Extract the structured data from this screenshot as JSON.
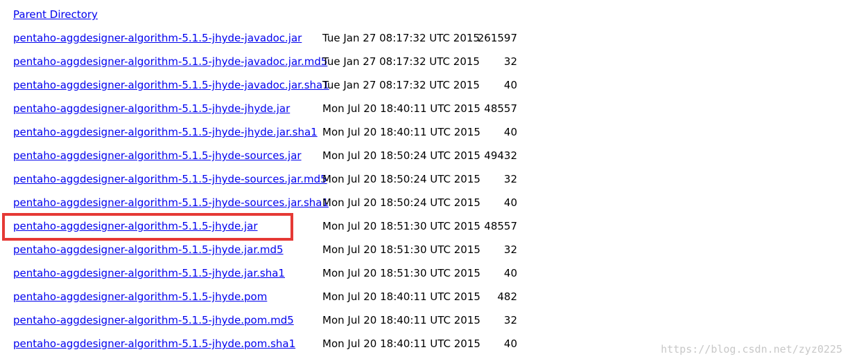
{
  "parent": {
    "label": "Parent Directory"
  },
  "files": [
    {
      "name": "pentaho-aggdesigner-algorithm-5.1.5-jhyde-javadoc.jar",
      "date": "Tue Jan 27 08:17:32 UTC 2015",
      "size": "261597"
    },
    {
      "name": "pentaho-aggdesigner-algorithm-5.1.5-jhyde-javadoc.jar.md5",
      "date": "Tue Jan 27 08:17:32 UTC 2015",
      "size": "32"
    },
    {
      "name": "pentaho-aggdesigner-algorithm-5.1.5-jhyde-javadoc.jar.sha1",
      "date": "Tue Jan 27 08:17:32 UTC 2015",
      "size": "40"
    },
    {
      "name": "pentaho-aggdesigner-algorithm-5.1.5-jhyde-jhyde.jar",
      "date": "Mon Jul 20 18:40:11 UTC 2015",
      "size": "48557"
    },
    {
      "name": "pentaho-aggdesigner-algorithm-5.1.5-jhyde-jhyde.jar.sha1",
      "date": "Mon Jul 20 18:40:11 UTC 2015",
      "size": "40"
    },
    {
      "name": "pentaho-aggdesigner-algorithm-5.1.5-jhyde-sources.jar",
      "date": "Mon Jul 20 18:50:24 UTC 2015",
      "size": "49432"
    },
    {
      "name": "pentaho-aggdesigner-algorithm-5.1.5-jhyde-sources.jar.md5",
      "date": "Mon Jul 20 18:50:24 UTC 2015",
      "size": "32"
    },
    {
      "name": "pentaho-aggdesigner-algorithm-5.1.5-jhyde-sources.jar.sha1",
      "date": "Mon Jul 20 18:50:24 UTC 2015",
      "size": "40"
    },
    {
      "name": "pentaho-aggdesigner-algorithm-5.1.5-jhyde.jar",
      "date": "Mon Jul 20 18:51:30 UTC 2015",
      "size": "48557"
    },
    {
      "name": "pentaho-aggdesigner-algorithm-5.1.5-jhyde.jar.md5",
      "date": "Mon Jul 20 18:51:30 UTC 2015",
      "size": "32"
    },
    {
      "name": "pentaho-aggdesigner-algorithm-5.1.5-jhyde.jar.sha1",
      "date": "Mon Jul 20 18:51:30 UTC 2015",
      "size": "40"
    },
    {
      "name": "pentaho-aggdesigner-algorithm-5.1.5-jhyde.pom",
      "date": "Mon Jul 20 18:40:11 UTC 2015",
      "size": "482"
    },
    {
      "name": "pentaho-aggdesigner-algorithm-5.1.5-jhyde.pom.md5",
      "date": "Mon Jul 20 18:40:11 UTC 2015",
      "size": "32"
    },
    {
      "name": "pentaho-aggdesigner-algorithm-5.1.5-jhyde.pom.sha1",
      "date": "Mon Jul 20 18:40:11 UTC 2015",
      "size": "40"
    }
  ],
  "watermark": {
    "text": "https://blog.csdn.net/zyz0225"
  },
  "colors": {
    "link": "#0000ee",
    "highlight": "#e53935",
    "watermark": "#c8c8c8"
  }
}
